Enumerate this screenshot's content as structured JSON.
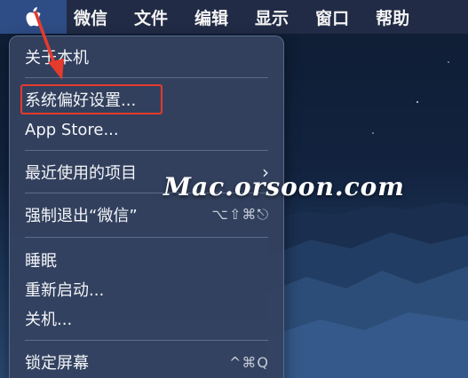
{
  "menubar": {
    "apple_icon": "apple-logo-icon",
    "items": [
      "微信",
      "文件",
      "编辑",
      "显示",
      "窗口",
      "帮助"
    ]
  },
  "apple_menu": {
    "items": {
      "about": "关于本机",
      "system_prefs": "系统偏好设置...",
      "app_store": "App Store...",
      "recent_items": "最近使用的项目",
      "force_quit": "强制退出“微信”",
      "force_quit_shortcut": "⌥⇧⌘⎋",
      "sleep": "睡眠",
      "restart": "重新启动...",
      "shutdown": "关机...",
      "lock_screen": "锁定屏幕",
      "lock_screen_shortcut": "^⌘Q"
    },
    "submenu_indicator": "›"
  },
  "annotation": {
    "highlight_color": "#e53b2c",
    "arrow_color": "#e53b2c"
  },
  "watermark": {
    "text": "Mac.orsoon.com"
  },
  "colors": {
    "menubar_bg": "#232d46",
    "apple_item_bg": "#2e4d86",
    "menu_bg": "#344260"
  }
}
